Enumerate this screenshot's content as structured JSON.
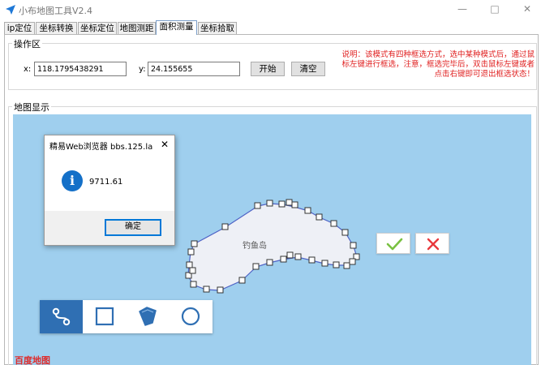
{
  "window": {
    "title": "小布地图工具V2.4",
    "minimize_glyph": "—",
    "maximize_glyph": "□",
    "close_glyph": "✕"
  },
  "tabs": [
    {
      "label": "ip定位",
      "active": false
    },
    {
      "label": "坐标转换",
      "active": false
    },
    {
      "label": "坐标定位",
      "active": false
    },
    {
      "label": "地图测距",
      "active": false
    },
    {
      "label": "面积测量",
      "active": true
    },
    {
      "label": "坐标拾取",
      "active": false
    }
  ],
  "operation": {
    "group_title": "操作区",
    "x_label": "x:",
    "x_value": "118.1795438291",
    "y_label": "y:",
    "y_value": "24.155655",
    "start_button": "开始",
    "clear_button": "清空",
    "note": "说明：该模式有四种框选方式，选中某种模式后，通过鼠标左键进行框选，注意，框选完毕后，双击鼠标左键或者点击右键即可退出框选状态！"
  },
  "map": {
    "group_title": "地图显示",
    "island_label": "钓鱼岛",
    "colors": {
      "water": "#9fcfee",
      "polygon_fill": "#eef0f6",
      "polygon_stroke": "#4f63c6",
      "confirm": "#7ac142",
      "cancel": "#e8383d",
      "tool_active": "#2f6fb3"
    },
    "tools": [
      {
        "name": "polyline-icon",
        "active": true
      },
      {
        "name": "rectangle-icon",
        "active": false
      },
      {
        "name": "polygon-icon",
        "active": false
      },
      {
        "name": "circle-icon",
        "active": false
      }
    ],
    "confirm_icon": "checkmark-icon",
    "cancel_icon": "x-mark-icon",
    "logo_text": "百度地图"
  },
  "dialog": {
    "title": "精易Web浏览器 bbs.125.la",
    "icon_glyph": "i",
    "close_glyph": "✕",
    "message": "9711.61",
    "ok_button": "确定"
  }
}
